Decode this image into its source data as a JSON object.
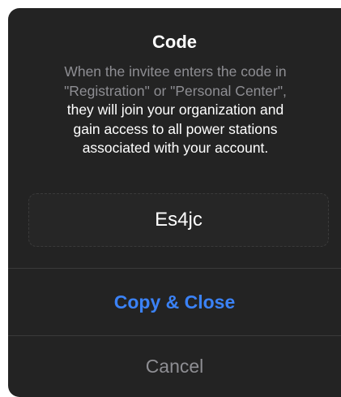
{
  "dialog": {
    "title": "Code",
    "message_lines": {
      "muted": [
        "When the invitee enters the code in",
        "\"Registration\" or \"Personal Center\","
      ],
      "bright": [
        "they will join your organization and",
        "gain access to all power stations",
        "associated with your account."
      ]
    },
    "code": "Es4jc",
    "copy_close_label": "Copy & Close",
    "cancel_label": "Cancel"
  },
  "colors": {
    "background": "#232323",
    "accent": "#3b82f6",
    "muted_text": "#8e8e93",
    "divider": "#3a3a3a"
  }
}
